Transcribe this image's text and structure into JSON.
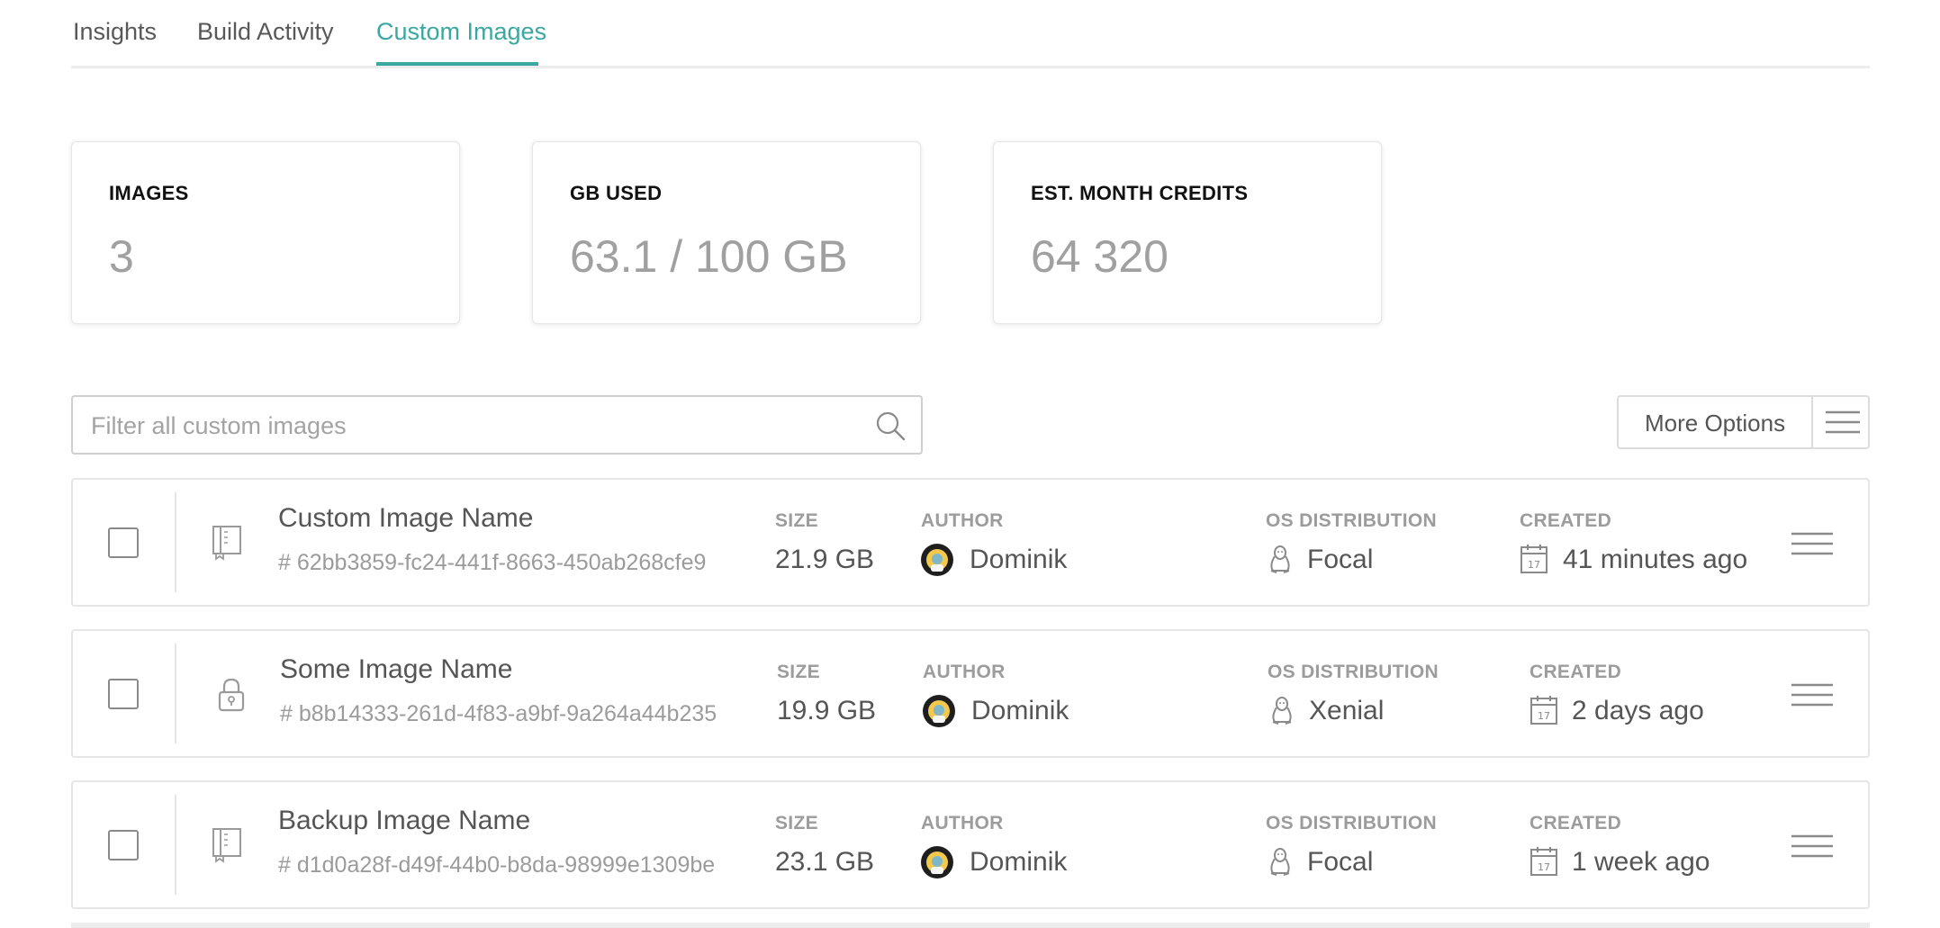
{
  "tabs": [
    "Insights",
    "Build Activity",
    "Custom Images"
  ],
  "active_tab": "Custom Images",
  "stats": {
    "images_label": "IMAGES",
    "images_value": "3",
    "gb_label": "GB USED",
    "gb_value": "63.1 / 100 GB",
    "credits_label": "EST. MONTH CREDITS",
    "credits_value": "64 320"
  },
  "filter": {
    "placeholder": "Filter all custom images"
  },
  "more_options": {
    "label": "More Options"
  },
  "columns": {
    "size": "SIZE",
    "author": "AUTHOR",
    "os": "OS DISTRIBUTION",
    "created": "CREATED"
  },
  "images": [
    {
      "name": "Custom Image Name",
      "id": "# 62bb3859-fc24-441f-8663-450ab268cfe9",
      "type_icon": "book-icon",
      "size": "21.9 GB",
      "author": "Dominik",
      "os": "Focal",
      "created": "41 minutes ago"
    },
    {
      "name": "Some Image Name",
      "id": "# b8b14333-261d-4f83-a9bf-9a264a44b235",
      "type_icon": "lock-icon",
      "size": "19.9 GB",
      "author": "Dominik",
      "os": "Xenial",
      "created": "2 days ago"
    },
    {
      "name": "Backup Image Name",
      "id": "# d1d0a28f-d49f-44b0-b8da-98999e1309be",
      "type_icon": "book-icon",
      "size": "23.1 GB",
      "author": "Dominik",
      "os": "Focal",
      "created": "1 week ago"
    }
  ],
  "colors": {
    "accent": "#3aa7a0",
    "border": "#e6e6e6",
    "muted": "#9c9c9c"
  }
}
